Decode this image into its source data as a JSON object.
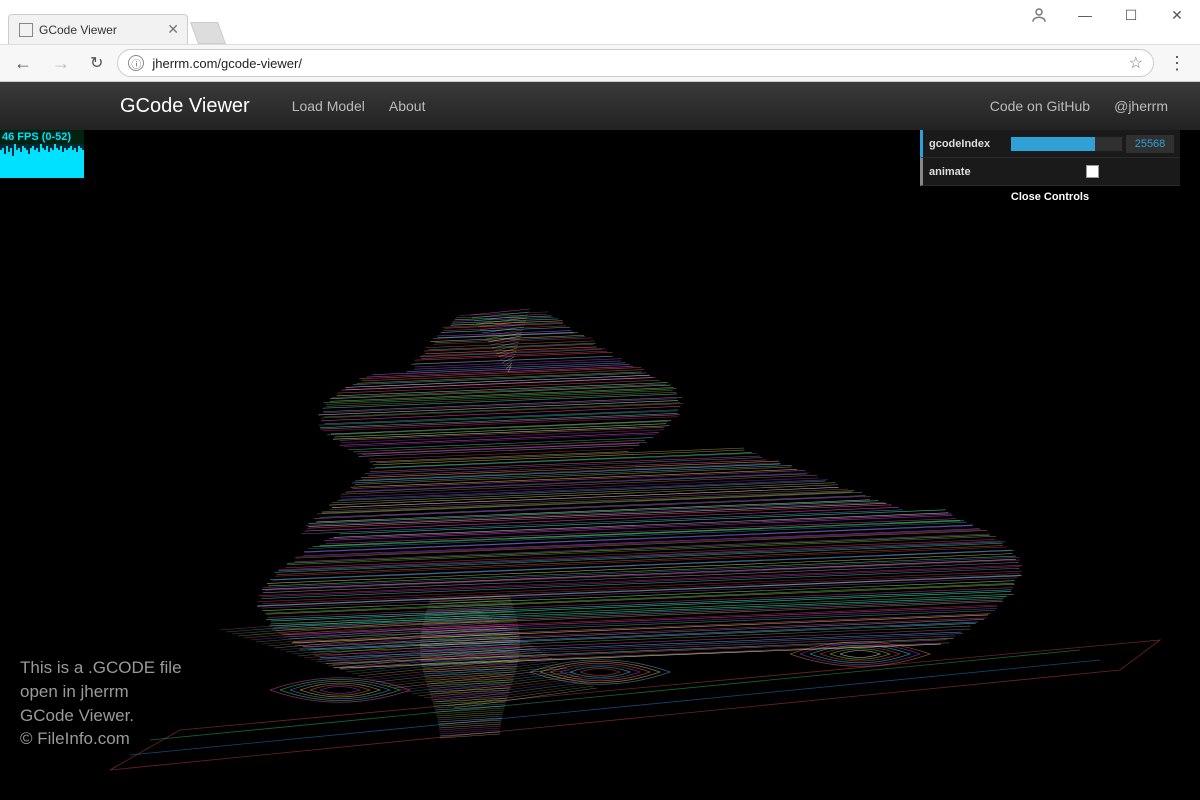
{
  "window": {
    "user_icon": "account",
    "minimize": "—",
    "maximize": "☐",
    "close": "✕"
  },
  "browser": {
    "tab_title": "GCode Viewer",
    "tab_close": "✕",
    "url": "jherrm.com/gcode-viewer/",
    "info_glyph": "ⓘ",
    "star_glyph": "☆",
    "menu_glyph": "⋮",
    "back_glyph": "←",
    "forward_glyph": "→",
    "reload_glyph": "↻"
  },
  "app": {
    "brand": "GCode Viewer",
    "nav": {
      "load_model": "Load Model",
      "about": "About",
      "code_on_github": "Code on GitHub",
      "twitter": "@jherrm"
    },
    "fps": {
      "label": "46 FPS (0-52)",
      "values": [
        28,
        30,
        24,
        32,
        26,
        30,
        22,
        34,
        28,
        30,
        26,
        32,
        30,
        28,
        24,
        30,
        32,
        28,
        30,
        26,
        34,
        30,
        28,
        32,
        26,
        30,
        28,
        34,
        30,
        28,
        32,
        26,
        30,
        28,
        30,
        32,
        28,
        30,
        26,
        32,
        30,
        28
      ]
    },
    "gui": {
      "gcode_index_label": "gcodeIndex",
      "gcode_index_value": "25568",
      "gcode_index_fill_pct": 76,
      "animate_label": "animate",
      "animate_checked": false,
      "close_label": "Close Controls"
    },
    "caption_lines": [
      "This is a .GCODE file",
      "open in jherrm",
      "GCode Viewer.",
      "© FileInfo.com"
    ]
  }
}
